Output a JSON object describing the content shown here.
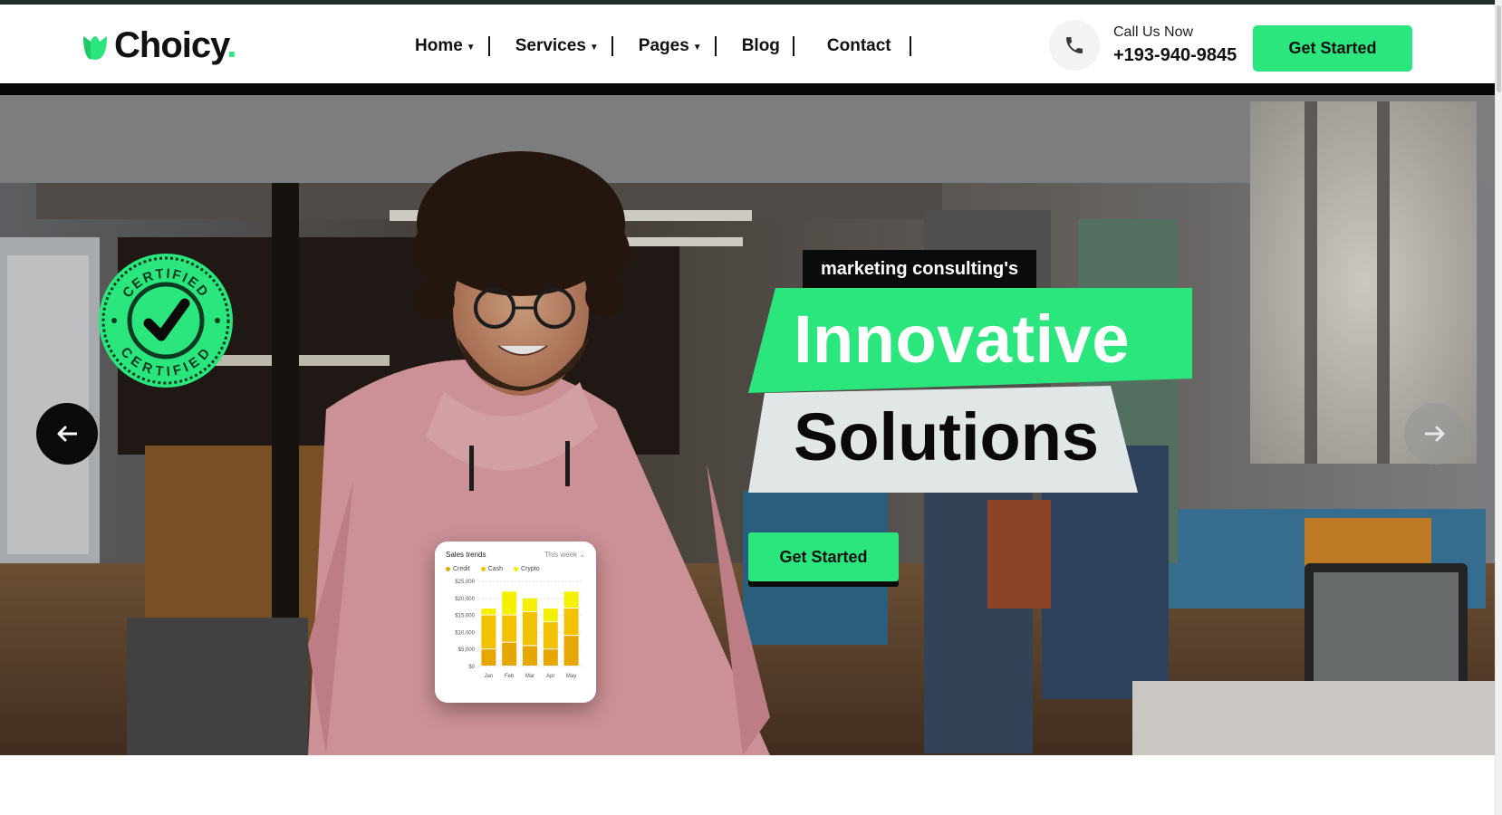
{
  "brand": {
    "name": "Choicy",
    "dot": ".",
    "accent": "#2ae67d",
    "dark": "#0b0b0b"
  },
  "nav": {
    "items": [
      {
        "label": "Home",
        "has_dropdown": true
      },
      {
        "label": "Services",
        "has_dropdown": true
      },
      {
        "label": "Pages",
        "has_dropdown": true
      },
      {
        "label": "Blog",
        "has_dropdown": false
      },
      {
        "label": "Contact",
        "has_dropdown": false
      }
    ]
  },
  "call": {
    "icon": "phone-icon",
    "label": "Call Us Now",
    "number": "+193-940-9845"
  },
  "header": {
    "cta_label": "Get Started"
  },
  "hero": {
    "badge_text": "CERTIFIED",
    "tag": "marketing consulting's",
    "title_line1": "Innovative",
    "title_line2": "Solutions",
    "cta_label": "Get Started",
    "prev_icon": "arrow-left-icon",
    "next_icon": "arrow-right-icon"
  },
  "card": {
    "title": "Sales trends",
    "period": "This week",
    "legend": [
      {
        "name": "Credit",
        "color": "#e6a700"
      },
      {
        "name": "Cash",
        "color": "#f2c200"
      },
      {
        "name": "Crypto",
        "color": "#f5f000"
      }
    ],
    "y_ticks": [
      "$25,000",
      "$20,000",
      "$15,000",
      "$10,000",
      "$5,000",
      "$0"
    ],
    "x_ticks": [
      "Jan",
      "Feb",
      "Mar",
      "Apr",
      "May"
    ],
    "bars": [
      {
        "credit": 5000,
        "cash": 10000,
        "crypto": 2000
      },
      {
        "credit": 7000,
        "cash": 8000,
        "crypto": 7000
      },
      {
        "credit": 6000,
        "cash": 10000,
        "crypto": 4000
      },
      {
        "credit": 5000,
        "cash": 8000,
        "crypto": 4000
      },
      {
        "credit": 9000,
        "cash": 8000,
        "crypto": 5000
      }
    ]
  }
}
